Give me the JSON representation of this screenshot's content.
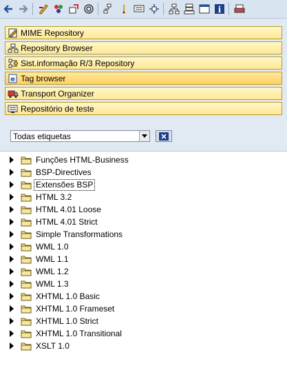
{
  "toolbar": {
    "icons": [
      "back-icon",
      "forward-icon",
      "edit-icon",
      "objects-icon",
      "move-icon",
      "spiral-icon",
      "tree-icon",
      "marker-icon",
      "display-icon",
      "navigate-icon",
      "hierarchy-icon",
      "stack-icon",
      "window-icon",
      "info-icon",
      "print-icon"
    ]
  },
  "nav": {
    "items": [
      {
        "label": "MIME Repository",
        "icon": "mime-icon"
      },
      {
        "label": "Repository Browser",
        "icon": "hierarchy-icon"
      },
      {
        "label": "Sist.informação R/3 Repository",
        "icon": "repo-info-icon"
      },
      {
        "label": "Tag browser",
        "icon": "tag-icon"
      },
      {
        "label": "Transport Organizer",
        "icon": "truck-icon"
      },
      {
        "label": "Repositório de teste",
        "icon": "test-repo-icon"
      }
    ]
  },
  "filter": {
    "selected": "Todas etiquetas"
  },
  "tree": {
    "items": [
      "Funções HTML-Business",
      "BSP-Directives",
      "Extensões BSP",
      "HTML 3.2",
      "HTML 4.01 Loose",
      "HTML 4.01 Strict",
      "Simple Transformations",
      "WML 1.0",
      "WML 1.1",
      "WML 1.2",
      "WML 1.3",
      "XHTML 1.0 Basic",
      "XHTML 1.0 Frameset",
      "XHTML 1.0 Strict",
      "XHTML 1.0 Transitional",
      "XSLT 1.0"
    ]
  }
}
